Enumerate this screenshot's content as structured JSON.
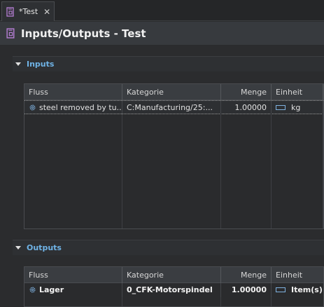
{
  "tab": {
    "label": "*Test",
    "close": "✕"
  },
  "header": {
    "title": "Inputs/Outputs - Test"
  },
  "inputs": {
    "title": "Inputs",
    "columns": [
      "Fluss",
      "Kategorie",
      "Menge",
      "Einheit"
    ],
    "rows": [
      {
        "flow": "steel removed by tu...",
        "category": "C:Manufacturing/25:...",
        "amount": "1.00000",
        "unit": "kg"
      }
    ]
  },
  "outputs": {
    "title": "Outputs",
    "columns": [
      "Fluss",
      "Kategorie",
      "Menge",
      "Einheit"
    ],
    "rows": [
      {
        "flow": "Lager",
        "category": "0_CFK-Motorspindel",
        "amount": "1.00000",
        "unit": "Item(s)"
      }
    ]
  },
  "colors": {
    "accent": "#6fb3e6",
    "icon_purple": "#b77fd6"
  }
}
